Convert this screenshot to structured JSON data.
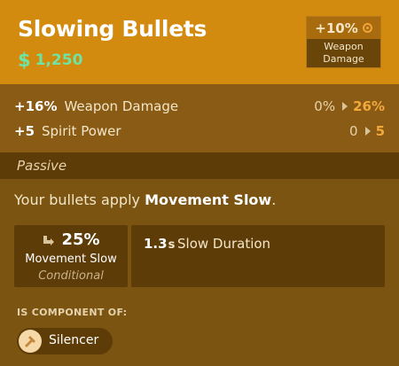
{
  "item": {
    "title": "Slowing Bullets",
    "cost_symbol": "$",
    "cost": "1,250"
  },
  "badge": {
    "value": "+10%",
    "icon": "weapon-damage-icon",
    "label_line1": "Weapon",
    "label_line2": "Damage"
  },
  "stats": [
    {
      "bonus": "+16%",
      "label": "Weapon Damage",
      "from": "0%",
      "to": "26%"
    },
    {
      "bonus": "+5",
      "label": "Spirit Power",
      "from": "0",
      "to": "5"
    }
  ],
  "passive": {
    "header": "Passive",
    "desc_prefix": "Your bullets apply ",
    "desc_bold": "Movement Slow",
    "desc_suffix": ".",
    "primary": {
      "icon": "slow-icon",
      "value": "25%",
      "name": "Movement Slow",
      "note": "Conditional"
    },
    "secondary": {
      "value": "1.3",
      "unit": "s",
      "label": "Slow Duration"
    }
  },
  "component": {
    "heading": "IS COMPONENT OF:",
    "item_name": "Silencer",
    "item_icon": "silencer-icon"
  },
  "colors": {
    "header_bg": "#d28a0f",
    "body_bg": "#7a5410",
    "accent": "#f3a83c",
    "cost": "#6fe3a3"
  }
}
